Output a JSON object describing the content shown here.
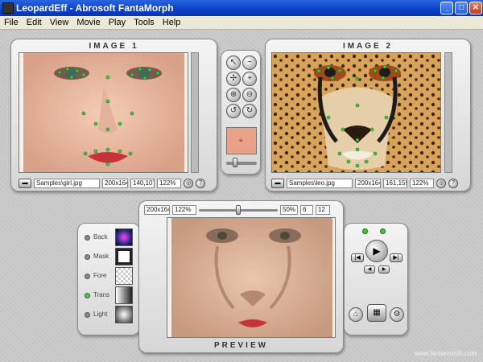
{
  "window": {
    "title": "LeopardEff - Abrosoft FantaMorph"
  },
  "menu": [
    "File",
    "Edit",
    "View",
    "Movie",
    "Play",
    "Tools",
    "Help"
  ],
  "image1": {
    "label": "IMAGE 1",
    "file": "Samples\\girl.jpg",
    "size": "200x164",
    "coords": "140,107",
    "zoom": "122%"
  },
  "image2": {
    "label": "IMAGE 2",
    "file": "Samples\\leo.jpg",
    "size": "200x164",
    "coords": "161,159",
    "zoom": "122%"
  },
  "preview": {
    "label": "PREVIEW",
    "size": "200x164",
    "zoom": "122%",
    "percent": "50%",
    "frame": "6",
    "total": "12",
    "slider_fraction": 0.5
  },
  "layers": [
    {
      "label": "Back",
      "on": false
    },
    {
      "label": "Mask",
      "on": false
    },
    {
      "label": "Fore",
      "on": false
    },
    {
      "label": "Trans",
      "on": true
    },
    {
      "label": "Light",
      "on": false
    }
  ],
  "watermark": "www.fantamorph.com",
  "colors": {
    "accent_dot": "#3bd13b",
    "titlebar": "#0a3fc8"
  }
}
